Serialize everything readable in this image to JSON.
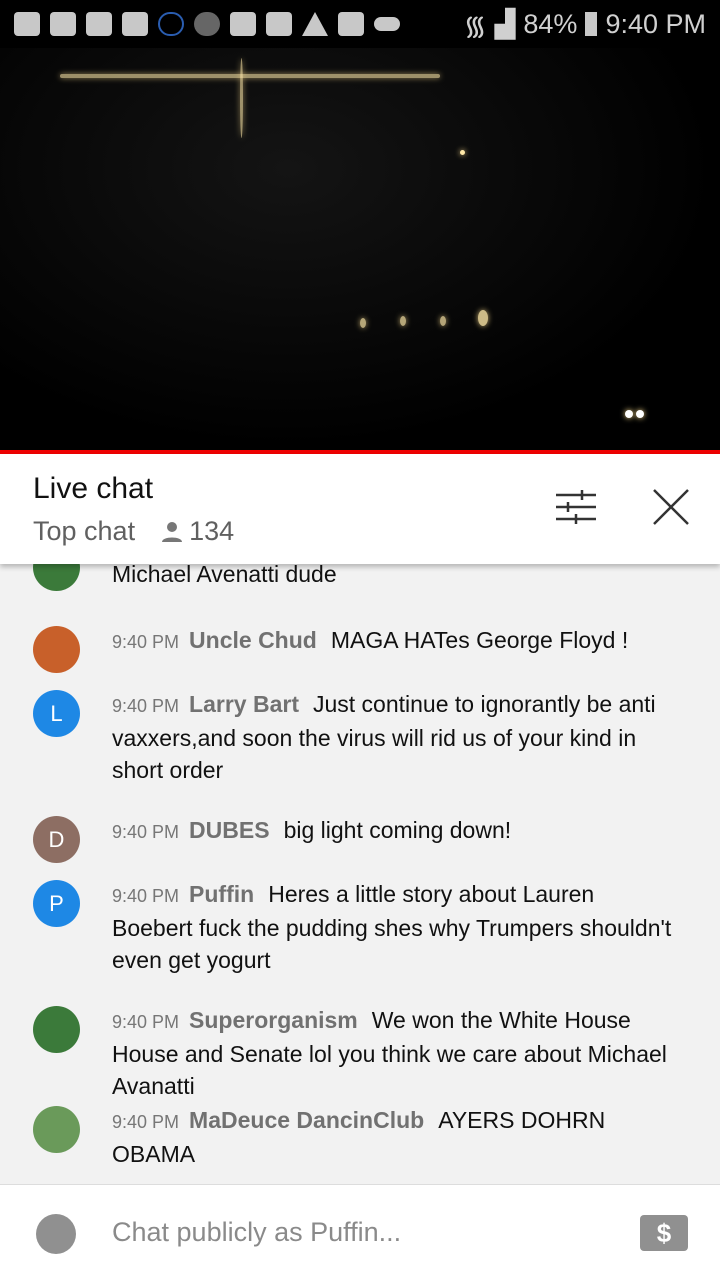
{
  "status_bar": {
    "battery": "84%",
    "time": "9:40 PM",
    "icons": [
      "message-icon",
      "youtube-icon",
      "youtube-icon",
      "crown-icon",
      "cloud-outline-icon",
      "m-app-icon",
      "folder-icon",
      "m-app-icon",
      "warning-icon",
      "image-icon",
      "cloud-icon",
      "wifi-icon",
      "signal-icon",
      "battery-icon"
    ]
  },
  "header": {
    "title": "Live chat",
    "mode": "Top chat",
    "viewers": "134"
  },
  "messages": [
    {
      "time": "",
      "author": "",
      "text": "Michael Avenatti dude",
      "avatar": "",
      "avatar_color": "#3b7a3a"
    },
    {
      "time": "9:40 PM",
      "author": "Uncle Chud",
      "text": "MAGA HATes George Floyd !",
      "avatar": "",
      "avatar_color": "#c8602a"
    },
    {
      "time": "9:40 PM",
      "author": "Larry Bart",
      "text": "Just continue to ignorantly be anti vaxxers,and soon the virus will rid us of your kind in short order",
      "avatar": "L",
      "avatar_color": "#1e88e5"
    },
    {
      "time": "9:40 PM",
      "author": "DUBES",
      "text": "big light coming down!",
      "avatar": "D",
      "avatar_color": "#8d6e63"
    },
    {
      "time": "9:40 PM",
      "author": "Puffin",
      "text": "Heres a little story about Lauren Boebert fuck the pudding shes why Trumpers shouldn't even get yogurt",
      "avatar": "P",
      "avatar_color": "#1e88e5"
    },
    {
      "time": "9:40 PM",
      "author": "Superorganism",
      "text": "We won the White House House and Senate lol you think we care about Michael Avanatti",
      "avatar": "",
      "avatar_color": "#3b7a3a"
    },
    {
      "time": "9:40 PM",
      "author": "MaDeuce DancinClub",
      "text": "AYERS DOHRN OBAMA",
      "avatar": "",
      "avatar_color": "#6a9a5a"
    }
  ],
  "input": {
    "placeholder": "Chat publicly as Puffin...",
    "super_chat": "$"
  },
  "colors": {
    "accent": "#ff0000",
    "header_bg": "#ffffff",
    "chat_bg": "#f2f2f2"
  }
}
